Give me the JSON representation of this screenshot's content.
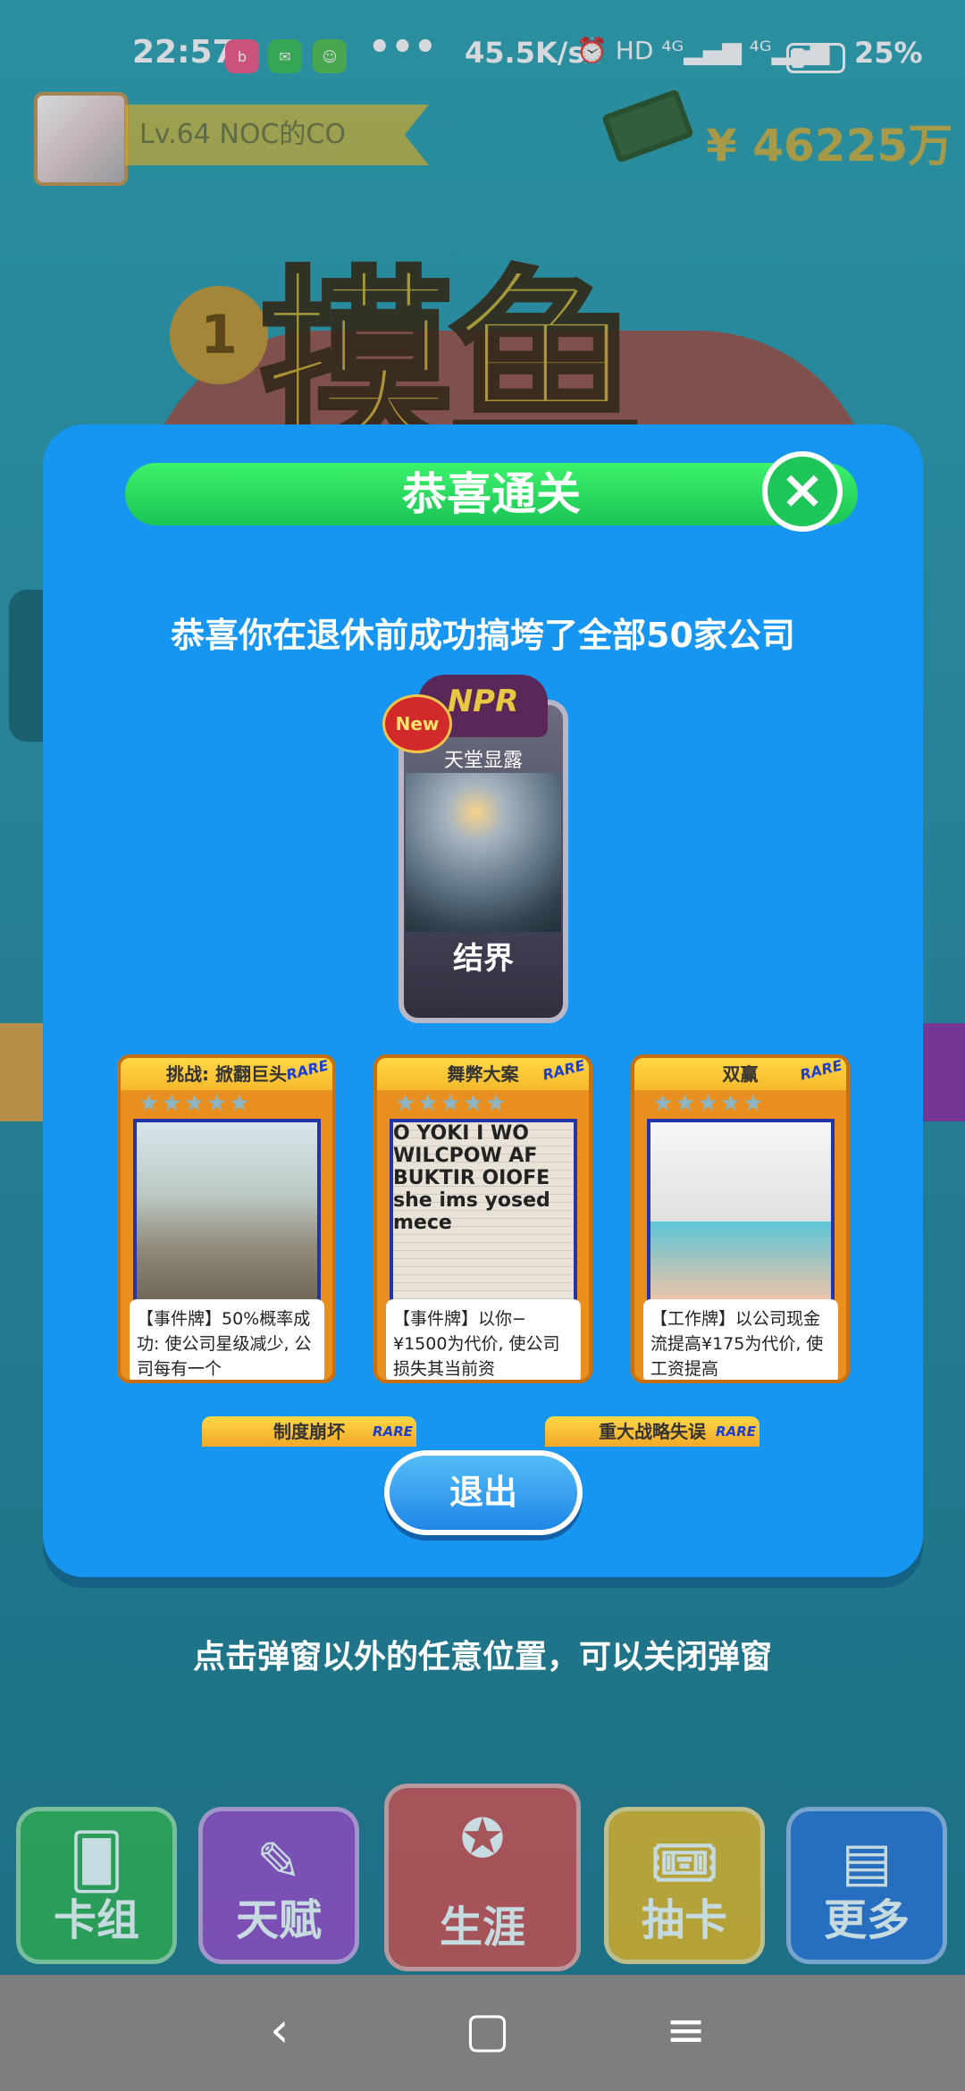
{
  "status_bar": {
    "time": "22:57",
    "apps": [
      "bilibili",
      "WeChat",
      "app"
    ],
    "more": "•••",
    "speed": "45.5K/s",
    "indicators": "⏰ HD ⁴ᴳ▂▄▆ ⁴ᴳ▂▄▆",
    "battery": "25%"
  },
  "player": {
    "level_name": "Lv.64 NOC的CO",
    "money": "¥ 46225万"
  },
  "banner": {
    "title": "摸鱼",
    "coin_label": "1"
  },
  "modal": {
    "header": "恭喜通关",
    "close_icon": "×",
    "message": "恭喜你在退休前成功搞垮了全部50家公司",
    "reward": {
      "badge": "New",
      "rarity": "NPR",
      "name": "天堂显露",
      "subtitle": "结界"
    },
    "cards": [
      {
        "title": "挑战: 掀翻巨头",
        "rare": "RARE",
        "stars": "★★★★★",
        "desc": "【事件牌】50%概率成功: 使公司星级减少, 公司每有一个"
      },
      {
        "title": "舞弊大案",
        "rare": "RARE",
        "stars": "★★★★★",
        "art_text": "O YOKI I WO WILCPOW AF BUKTIR OIOFE she ims yosed mece",
        "desc": "【事件牌】以你−¥1500为代价, 使公司损失其当前资"
      },
      {
        "title": "双赢",
        "rare": "RARE",
        "stars": "★★★★★",
        "desc": "【工作牌】以公司现金流提高¥175为代价, 使工资提高"
      }
    ],
    "mini_cards": [
      {
        "title": "制度崩坏",
        "rare": "RARE"
      },
      {
        "title": "重大战略失误",
        "rare": "RARE"
      }
    ],
    "exit_label": "退出"
  },
  "hint": "点击弹窗以外的任意位置，可以关闭弹窗",
  "bottom_nav": [
    {
      "label": "卡组",
      "icon": "cards-icon",
      "color": "#2fae4a"
    },
    {
      "label": "天赋",
      "icon": "scroll-icon",
      "color": "#9a45c4"
    },
    {
      "label": "生涯",
      "icon": "medal-icon",
      "color": "#d24a4a"
    },
    {
      "label": "抽卡",
      "icon": "ticket-icon",
      "color": "#e7b321"
    },
    {
      "label": "更多",
      "icon": "chart-icon",
      "color": "#2a6ed2"
    }
  ],
  "system_nav": {
    "back": "‹",
    "home": "▢",
    "menu": "≡"
  }
}
